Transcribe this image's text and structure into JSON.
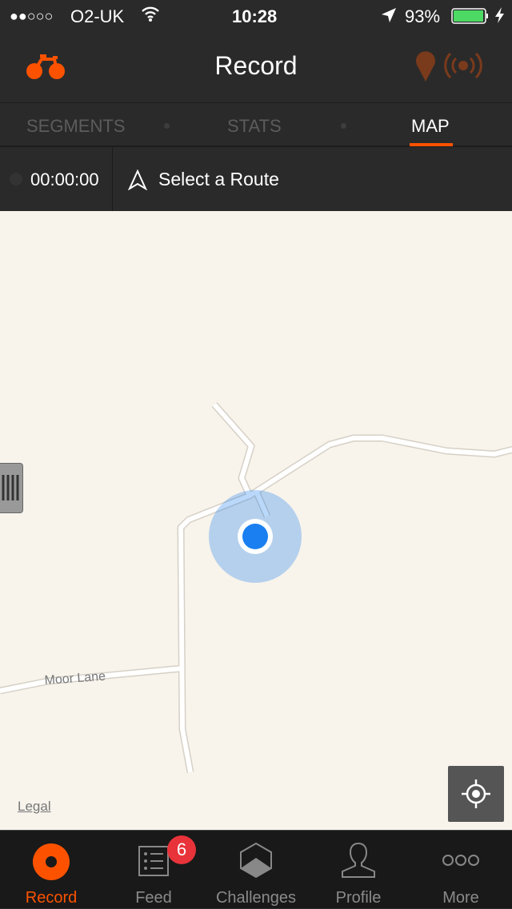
{
  "status": {
    "carrier": "O2-UK",
    "time": "10:28",
    "battery": "93%",
    "signal_bars": 2,
    "battery_level": 0.93
  },
  "header": {
    "title": "Record",
    "sport_icon": "bike-icon",
    "accent": "#fc5200"
  },
  "tabs": [
    {
      "label": "SEGMENTS"
    },
    {
      "label": "STATS"
    },
    {
      "label": "MAP",
      "active": true
    }
  ],
  "record_bar": {
    "timer": "00:00:00",
    "route_label": "Select a Route"
  },
  "map": {
    "road_label": "Moor Lane",
    "legal": "Legal"
  },
  "tabbar": {
    "items": [
      {
        "label": "Record",
        "active": true
      },
      {
        "label": "Feed",
        "badge": "6"
      },
      {
        "label": "Challenges"
      },
      {
        "label": "Profile"
      },
      {
        "label": "More"
      }
    ]
  }
}
